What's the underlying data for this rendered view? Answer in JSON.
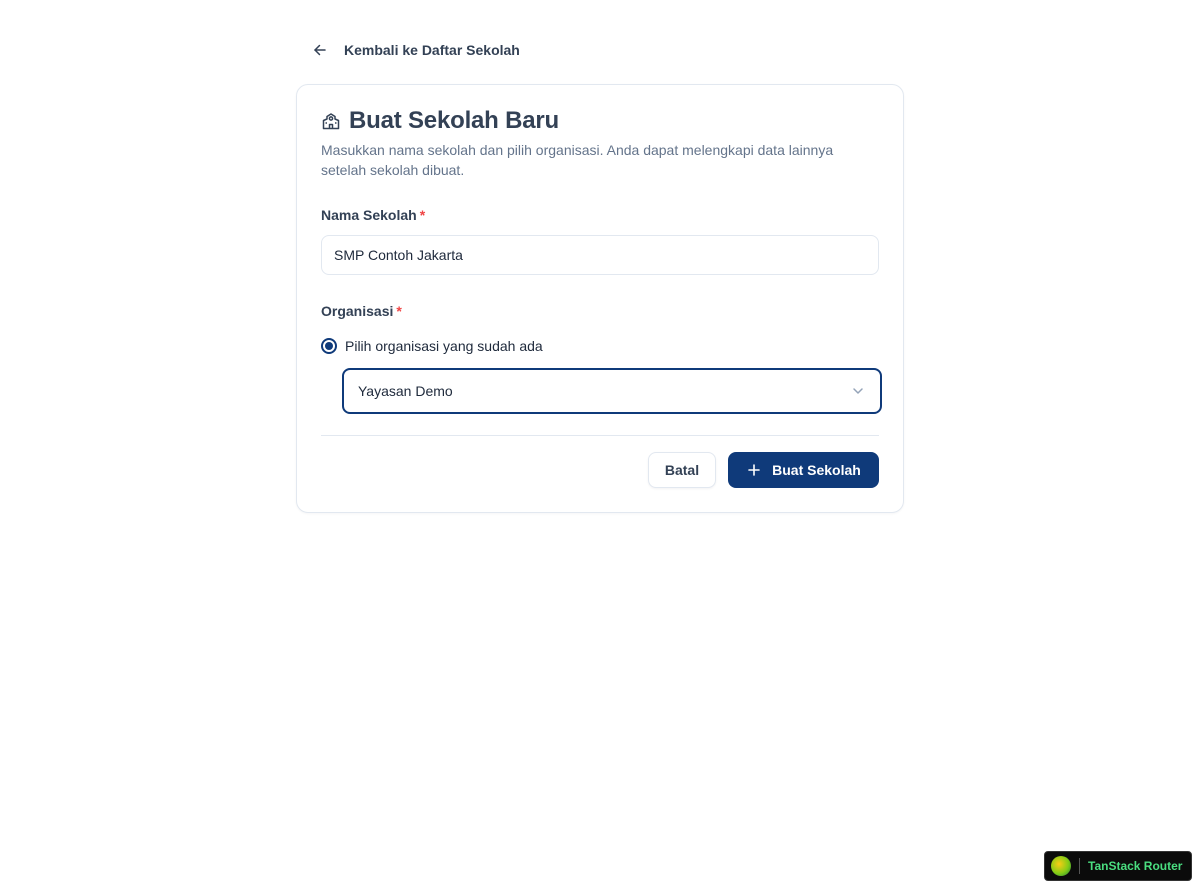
{
  "nav": {
    "back_label": "Kembali ke Daftar Sekolah",
    "back_icon": "arrow-left-icon"
  },
  "card": {
    "title": "Buat Sekolah Baru",
    "title_icon": "school-icon",
    "description": "Masukkan nama sekolah dan pilih organisasi. Anda dapat melengkapi data lainnya setelah sekolah dibuat."
  },
  "form": {
    "school_name": {
      "label": "Nama Sekolah",
      "required_mark": "*",
      "value": "SMP Contoh Jakarta"
    },
    "organization": {
      "label": "Organisasi",
      "required_mark": "*",
      "radio_option_label": "Pilih organisasi yang sudah ada",
      "radio_selected": true,
      "select_value": "Yayasan Demo",
      "select_icon": "chevron-down-icon"
    }
  },
  "actions": {
    "cancel_label": "Batal",
    "submit_label": "Buat Sekolah",
    "submit_icon": "plus-icon"
  },
  "devtools": {
    "label": "TanStack Router"
  },
  "colors": {
    "primary": "#0f3a7a",
    "required": "#ef4444",
    "muted_text": "#64748b",
    "border": "#e2e8f0",
    "devtools_text": "#4ade80"
  }
}
